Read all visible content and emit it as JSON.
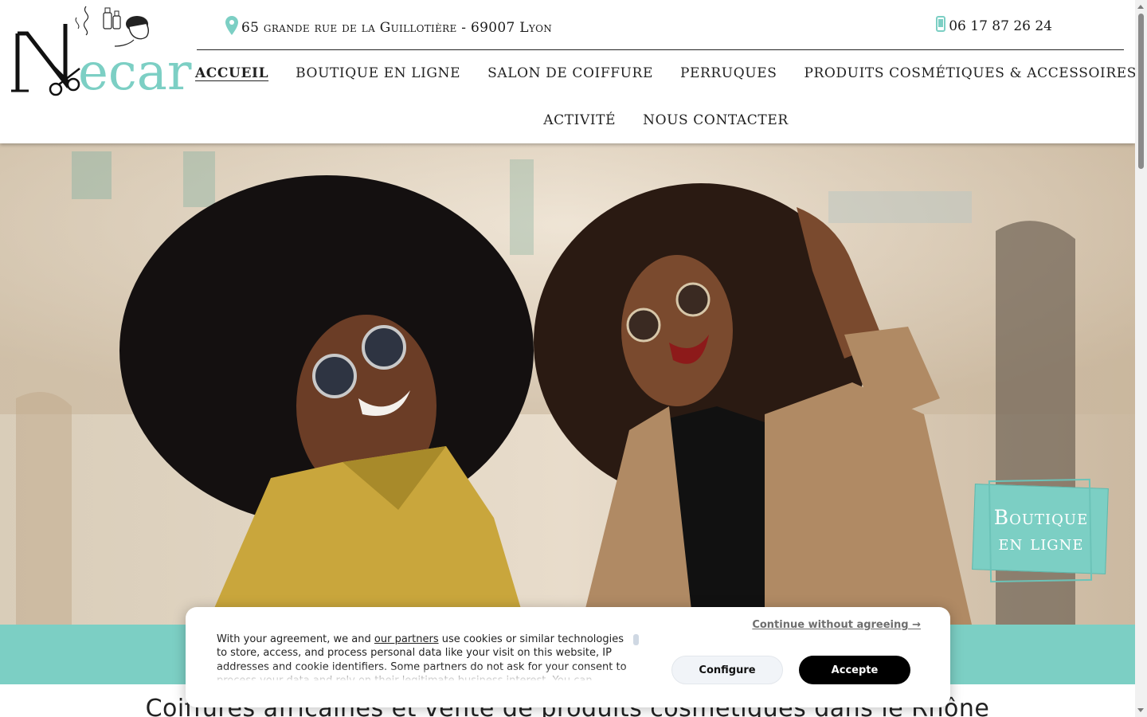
{
  "brand": {
    "logo_text": "ecar",
    "logo_initial": "N",
    "accent_color": "#7ccfc4"
  },
  "topbar": {
    "address_icon": "map-pin-icon",
    "address": "65 grande rue de la Guillotière - 69007 Lyon",
    "phone_icon": "mobile-phone-icon",
    "phone": "06 17 87 26 24"
  },
  "nav": {
    "items": [
      {
        "label": "Accueil",
        "active": true
      },
      {
        "label": "Boutique en ligne"
      },
      {
        "label": "Salon de coiffure"
      },
      {
        "label": "Perruques"
      },
      {
        "label": "Produits cosmétiques & accessoires"
      },
      {
        "label": "Activité"
      },
      {
        "label": "Nous contacter"
      }
    ]
  },
  "hero": {
    "badge_line1": "Boutique",
    "badge_line2": "en ligne"
  },
  "section": {
    "heading": "Coiffures africaines et vente de produits cosmétiques dans le Rhône"
  },
  "cookie": {
    "continue_label": "Continue without agreeing →",
    "text_before_link": "With your agreement, we and ",
    "link_label": "our partners",
    "text_after_link": " use cookies or similar technologies to store, access, and process personal data like your visit on this website, IP addresses and cookie identifiers. Some partners do not ask for your consent to process your data and rely on their legitimate business interest. You can",
    "configure_label": "Configure",
    "accept_label": "Accepte"
  }
}
